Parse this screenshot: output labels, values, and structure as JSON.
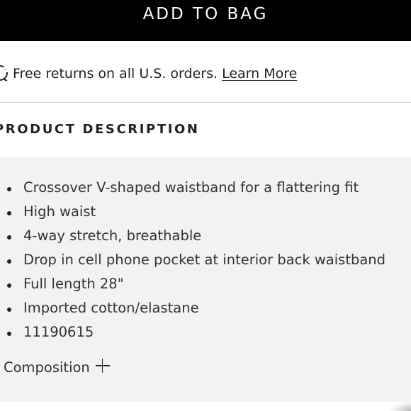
{
  "add_to_bag": {
    "label": "ADD TO BAG"
  },
  "returns": {
    "icon": "returns-icon",
    "text": "Free returns on all U.S. orders.",
    "link_label": "Learn More"
  },
  "product_description": {
    "title": "PRODUCT DESCRIPTION",
    "bullets": [
      "Crossover V-shaped waistband for a flattering fit",
      "High waist",
      "4-way stretch, breathable",
      "Drop in cell phone pocket at interior back waistband",
      "Full length 28\"",
      "Imported cotton/elastane",
      "11190615"
    ],
    "composition_label": "Composition",
    "composition_icon": "plus-icon"
  },
  "colors": {
    "button_bg": "#000000",
    "button_text": "#ffffff",
    "panel_bg": "#f2f2f2",
    "text": "#222222"
  }
}
